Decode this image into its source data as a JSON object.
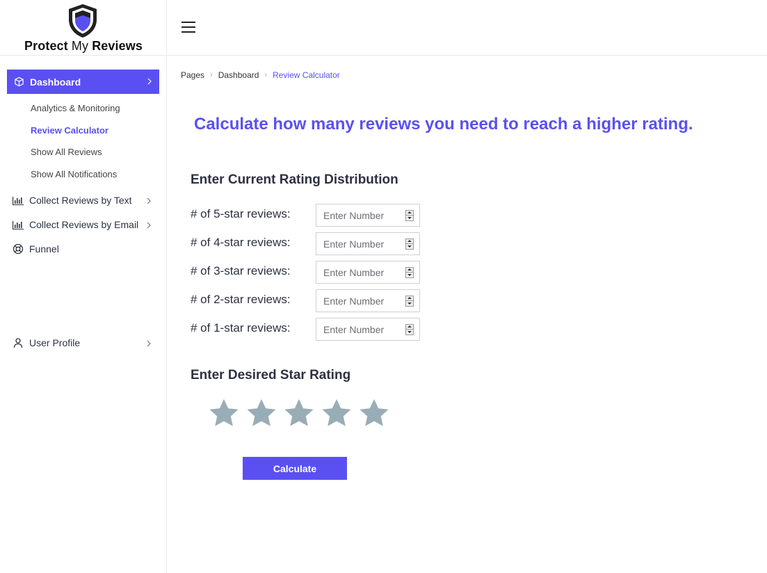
{
  "brand": {
    "name_bold": "Protect",
    "name_thin": "My",
    "name_bold2": "Reviews"
  },
  "sidebar": {
    "active": {
      "label": "Dashboard",
      "icon": "cube-icon"
    },
    "subitems": [
      {
        "label": "Analytics & Monitoring",
        "active": false
      },
      {
        "label": "Review Calculator",
        "active": true
      },
      {
        "label": "Show All Reviews",
        "active": false
      },
      {
        "label": "Show All Notifications",
        "active": false
      }
    ],
    "items": [
      {
        "label": "Collect Reviews by Text",
        "icon": "bar-chart-icon"
      },
      {
        "label": "Collect Reviews by Email",
        "icon": "bar-chart-icon"
      },
      {
        "label": "Funnel",
        "icon": "lifebuoy-icon"
      },
      {
        "label": "User Profile",
        "icon": "user-icon"
      }
    ]
  },
  "breadcrumb": [
    {
      "label": "Pages"
    },
    {
      "label": "Dashboard"
    },
    {
      "label": "Review Calculator"
    }
  ],
  "headline": "Calculate how many reviews you need to reach a higher rating.",
  "distribution": {
    "title": "Enter Current Rating Distribution",
    "placeholder": "Enter Number",
    "rows": [
      {
        "label": "# of 5-star reviews:"
      },
      {
        "label": "# of 4-star reviews:"
      },
      {
        "label": "# of 3-star reviews:"
      },
      {
        "label": "# of 2-star reviews:"
      },
      {
        "label": "# of 1-star reviews:"
      }
    ]
  },
  "desired": {
    "title": "Enter Desired Star Rating",
    "star_count": 5,
    "star_color": "#99adb6"
  },
  "calculate_label": "Calculate",
  "colors": {
    "accent": "#5a50f2"
  }
}
